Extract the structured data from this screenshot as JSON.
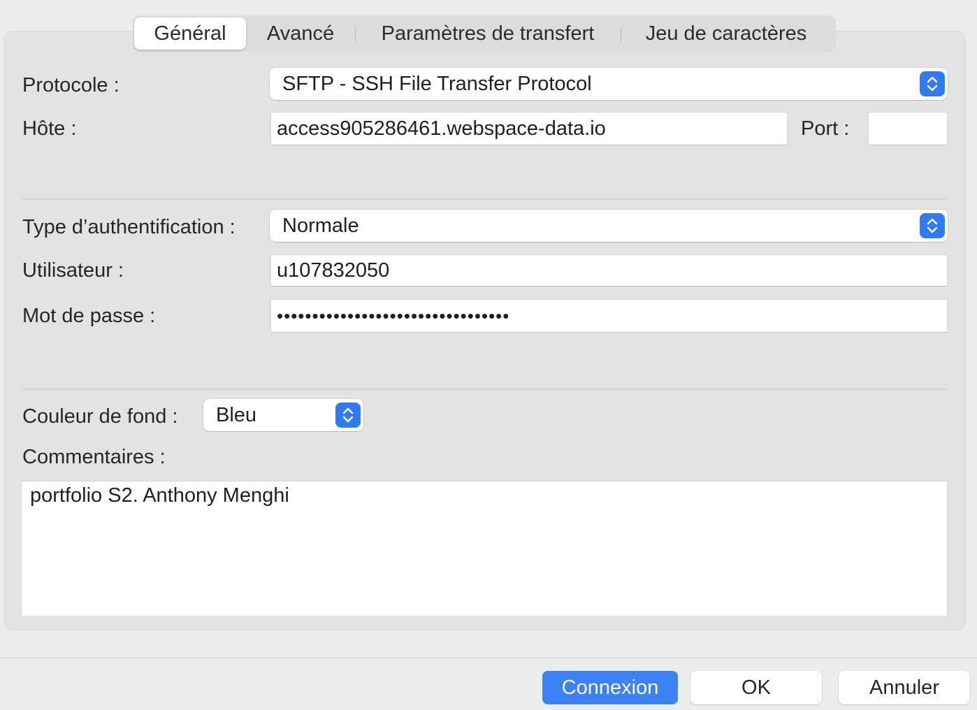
{
  "tabs": [
    {
      "label": "Général",
      "active": true
    },
    {
      "label": "Avancé",
      "active": false
    },
    {
      "label": "Paramètres de transfert",
      "active": false
    },
    {
      "label": "Jeu de caractères",
      "active": false
    }
  ],
  "protocol": {
    "label": "Protocole :",
    "value": "SFTP - SSH File Transfer Protocol"
  },
  "host": {
    "label": "Hôte :",
    "value": "access905286461.webspace-data.io"
  },
  "port": {
    "label": "Port :",
    "value": ""
  },
  "auth_type": {
    "label": "Type d’authentification :",
    "value": "Normale"
  },
  "user": {
    "label": "Utilisateur :",
    "value": "u107832050"
  },
  "password": {
    "label": "Mot de passe :",
    "masked_value": "•••••••••••••••••••••••••••••••••"
  },
  "background_color": {
    "label": "Couleur de fond :",
    "value": "Bleu"
  },
  "comments": {
    "label": "Commentaires :",
    "value": "portfolio S2. Anthony Menghi"
  },
  "buttons": {
    "connect": "Connexion",
    "ok": "OK",
    "cancel": "Annuler"
  },
  "colors": {
    "accent": "#2f7bf6",
    "primary_button": "#3b82f6"
  },
  "icons": {
    "select_stepper": "chevron-up-down-icon"
  }
}
